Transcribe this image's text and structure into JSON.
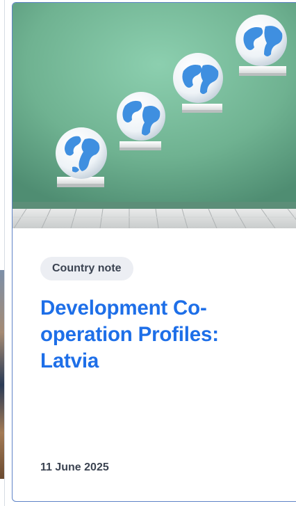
{
  "card": {
    "tag": "Country note",
    "title": "Development Co-operation Profiles: Latvia",
    "date": "11 June 2025",
    "image_description_icon": "globes-on-shelves-image"
  },
  "colors": {
    "accent": "#1e6fe8",
    "card_border": "#5e83c7",
    "tag_background": "#eceef3",
    "text_dark": "#3b4351"
  }
}
